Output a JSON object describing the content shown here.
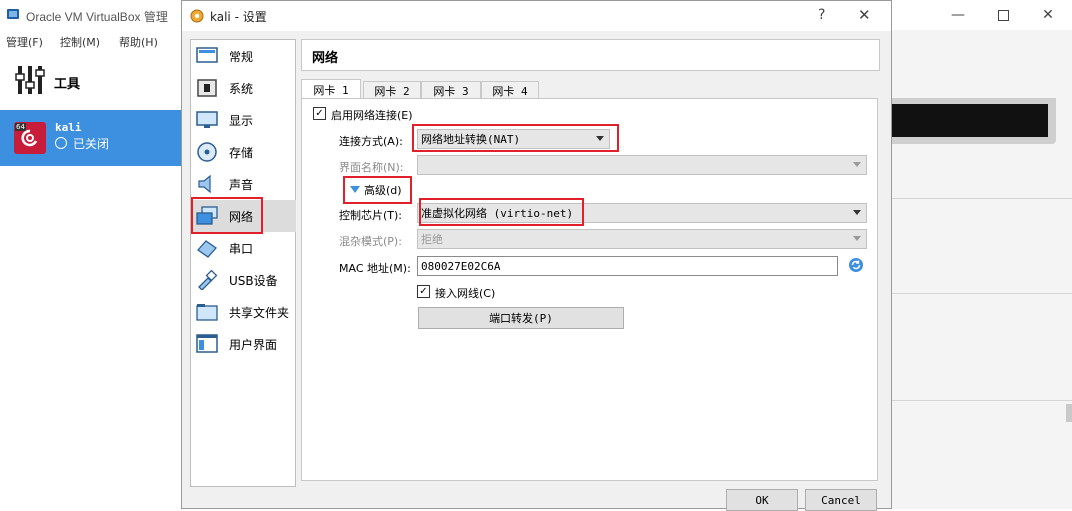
{
  "main_window": {
    "title": "Oracle VM VirtualBox 管理",
    "menu": [
      "管理(F)",
      "控制(M)",
      "帮助(H)"
    ],
    "tools_label": "工具",
    "vm": {
      "name": "kali",
      "state": "已关闭",
      "badge": "64"
    }
  },
  "dialog": {
    "title": "kali - 设置",
    "help_glyph": "?",
    "close_glyph": "✕",
    "nav": [
      {
        "label": "常规",
        "icon": "general-icon"
      },
      {
        "label": "系统",
        "icon": "system-icon"
      },
      {
        "label": "显示",
        "icon": "display-icon"
      },
      {
        "label": "存储",
        "icon": "storage-icon"
      },
      {
        "label": "声音",
        "icon": "audio-icon"
      },
      {
        "label": "网络",
        "icon": "network-icon",
        "selected": true
      },
      {
        "label": "串口",
        "icon": "serial-port-icon"
      },
      {
        "label": "USB设备",
        "icon": "usb-icon"
      },
      {
        "label": "共享文件夹",
        "icon": "shared-folder-icon"
      },
      {
        "label": "用户界面",
        "icon": "user-interface-icon"
      }
    ],
    "section_title": "网络",
    "tabs": [
      "网卡 1",
      "网卡 2",
      "网卡 3",
      "网卡 4"
    ],
    "active_tab": 0,
    "enable_adapter": "启用网络连接(E)",
    "attached_to_label": "连接方式(A):",
    "attached_to_value": "网络地址转换(NAT)",
    "name_label": "界面名称(N):",
    "name_value": "",
    "advanced_label": "高级(d)",
    "adapter_type_label": "控制芯片(T):",
    "adapter_type_value": "准虚拟化网络 (virtio-net)",
    "promiscuous_label": "混杂模式(P):",
    "promiscuous_value": "拒绝",
    "mac_label": "MAC 地址(M):",
    "mac_value": "080027E02C6A",
    "cable_connected": "接入网线(C)",
    "port_forwarding": "端口转发(P)",
    "ok": "OK",
    "cancel": "Cancel"
  },
  "colors": {
    "highlight": "#e0212b",
    "selection": "#3d8fe0"
  }
}
